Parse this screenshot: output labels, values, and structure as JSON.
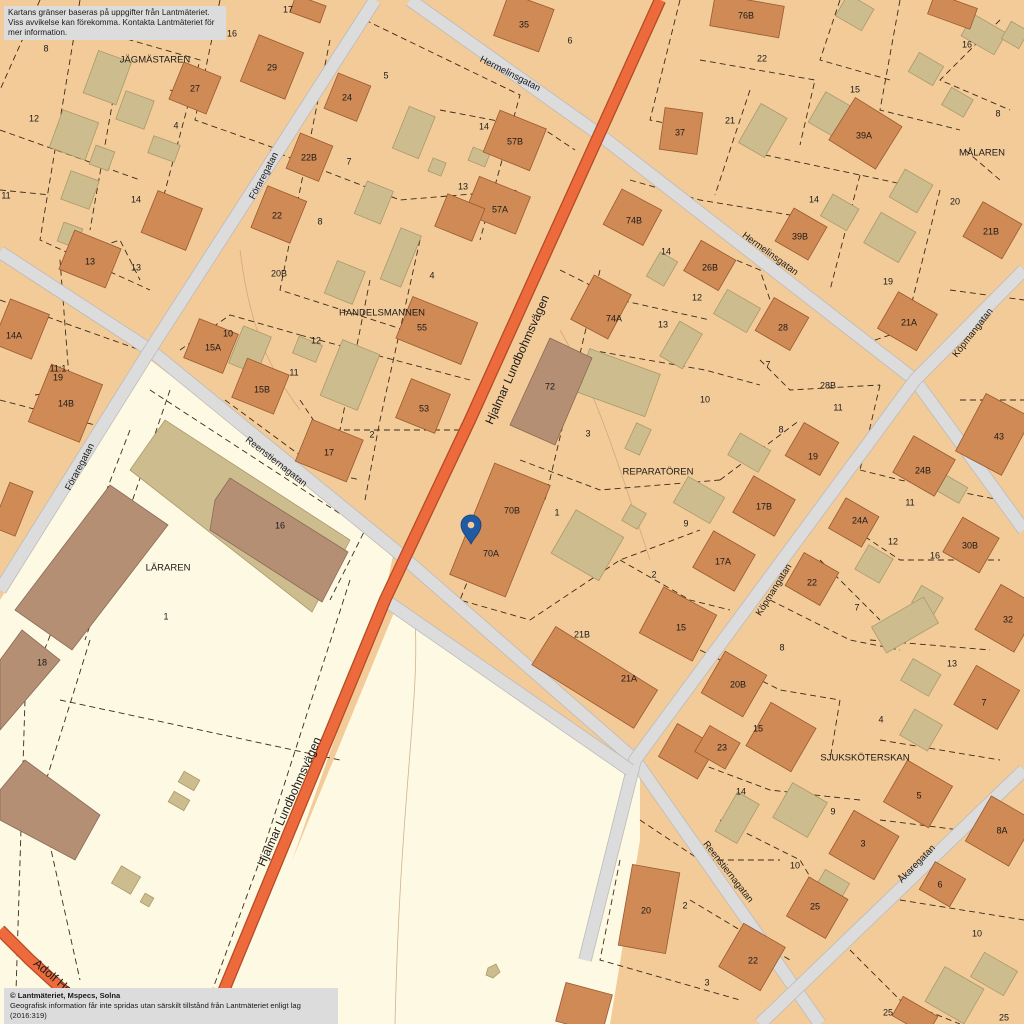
{
  "notice": {
    "line1": "Kartans gränser baseras på uppgifter från Lantmäteriet.",
    "line2": "Viss avvikelse kan förekomma. Kontakta Lantmäteriet för mer information."
  },
  "copyright": {
    "line1": "© Lantmäteriet, Mspecs, Solna",
    "line2": "Geografisk information får inte spridas utan särskilt tillstånd från Lantmäteriet enligt lag (2016:319)"
  },
  "colors": {
    "land": "#f3cb98",
    "school_ground": "#fdf9e3",
    "building_residential": "#cf8a55",
    "building_outbuilding": "#cdbd8e",
    "building_public": "#b58f74",
    "road": "#dcdcdc",
    "main_road": "#ec6a3c",
    "marker": "#1f5aa3"
  },
  "marker": {
    "icon": "location-pin-icon"
  },
  "streets": [
    "Hermelinsgatan",
    "Hermelinsgatan",
    "Föraregatan",
    "Föraregatan",
    "Hjalmar Lundbohmsvägen",
    "Hjalmar Lundbohmsvägen",
    "Reenstiernagatan",
    "Reenstiernagatan",
    "Köpmangatan",
    "Köpmangatan",
    "Åkaregatan",
    "Adolf Hedi"
  ],
  "blocks": [
    "JÄGMÄSTAREN",
    "HANDELSMANNEN",
    "MÅLAREN",
    "REPARATÖREN",
    "LÄRAREN",
    "SJUKSKÖTERSKAN"
  ],
  "building_labels": [
    "35",
    "76B",
    "29",
    "27",
    "24",
    "57B",
    "37",
    "39A",
    "22B",
    "57A",
    "22",
    "74B",
    "39B",
    "21B",
    "13",
    "26B",
    "14A",
    "15A",
    "55",
    "74A",
    "28",
    "21A",
    "72",
    "15B",
    "14B",
    "53",
    "43",
    "17",
    "24B",
    "19",
    "70B",
    "17B",
    "24A",
    "16",
    "70A",
    "30B",
    "17A",
    "22",
    "15",
    "32",
    "21B",
    "21A",
    "20B",
    "7",
    "18",
    "23",
    "5",
    "3",
    "8A",
    "6",
    "20",
    "25",
    "22",
    "25"
  ],
  "plot_numbers": [
    "17",
    "16",
    "8",
    "5",
    "6",
    "22",
    "16",
    "12",
    "4",
    "14",
    "15",
    "21",
    "8",
    "7",
    "13",
    "11",
    "14",
    "13",
    "8",
    "14",
    "20",
    "20B",
    "4",
    "14",
    "12",
    "13",
    "19",
    "10",
    "12",
    "11",
    "11:1",
    "19",
    "10",
    "7",
    "28B",
    "11",
    "2",
    "3",
    "8",
    "1",
    "11",
    "9",
    "12",
    "16",
    "2",
    "7",
    "8",
    "1",
    "13",
    "15",
    "4",
    "14",
    "9",
    "10",
    "2",
    "3",
    "10",
    "25"
  ]
}
